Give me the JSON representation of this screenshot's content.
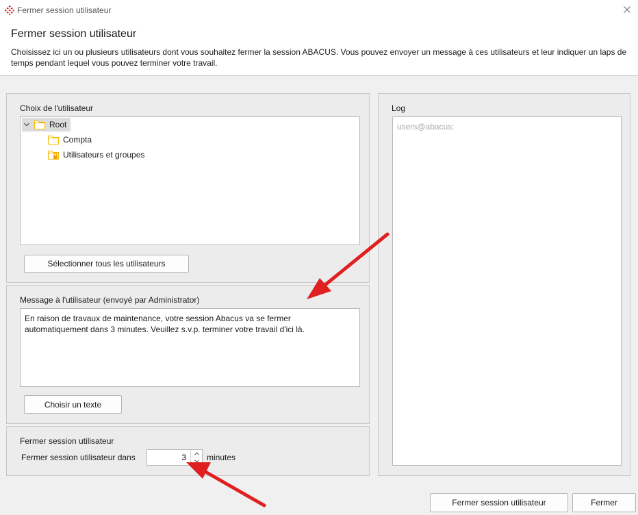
{
  "window": {
    "title": "Fermer session utilisateur",
    "close_glyph": "✕"
  },
  "header": {
    "title": "Fermer session utilisateur",
    "description": "Choisissez ici un ou plusieurs utilisateurs dont vous souhaitez fermer la session ABACUS. Vous pouvez envoyer un message à ces utilisateurs et leur indiquer un laps de temps pendant lequel vous pouvez terminer votre travail."
  },
  "user_choice": {
    "label": "Choix de l'utilisateur",
    "tree": {
      "root": "Root",
      "children": [
        "Compta",
        "Utilisateurs et groupes"
      ]
    },
    "select_all_button": "Sélectionner tous les utilisateurs"
  },
  "message": {
    "label": "Message à l'utilisateur (envoyé par Administrator)",
    "text": "En raison de travaux de maintenance, votre session Abacus va se fermer automatiquement dans 3 minutes. Veuillez s.v.p. terminer votre travail d'ici là.",
    "choose_text_button": "Choisir un texte"
  },
  "close_session": {
    "label": "Fermer session utilisateur",
    "field_label": "Fermer session utilisateur dans",
    "minutes_value": "3",
    "unit": "minutes"
  },
  "log": {
    "label": "Log",
    "content": "users@abacus:"
  },
  "footer": {
    "close_session_button": "Fermer session utilisateur",
    "close_button": "Fermer"
  },
  "colors": {
    "folder": "#f5b800",
    "lock": "#f0a000",
    "arrow": "#e02020",
    "app_icon": "#d62b2b"
  }
}
